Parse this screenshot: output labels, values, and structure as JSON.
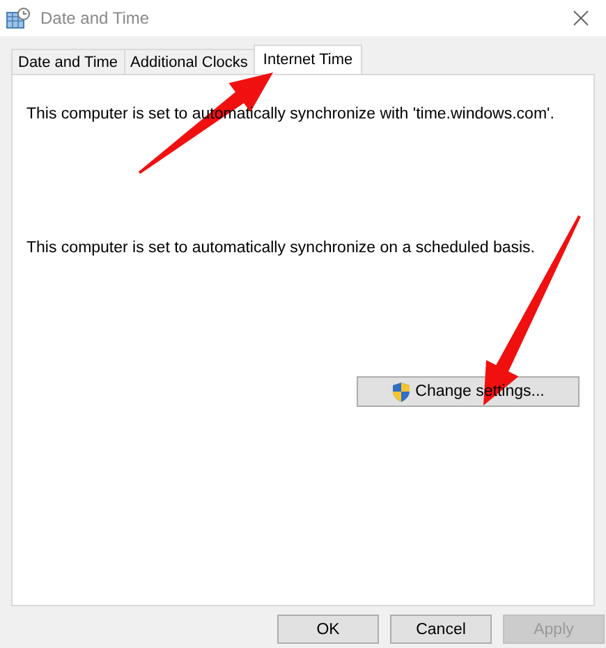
{
  "window": {
    "title": "Date and Time"
  },
  "tabs": [
    {
      "label": "Date and Time",
      "selected": false
    },
    {
      "label": "Additional Clocks",
      "selected": false
    },
    {
      "label": "Internet Time",
      "selected": true
    }
  ],
  "messages": [
    "This computer is set to automatically synchronize with 'time.windows.com'.",
    "This computer is set to automatically synchronize on a scheduled basis."
  ],
  "change_button": {
    "label": "Change settings..."
  },
  "buttons": [
    {
      "label": "OK",
      "disabled": false
    },
    {
      "label": "Cancel",
      "disabled": false
    },
    {
      "label": "Apply",
      "disabled": true
    }
  ],
  "annotations": [
    {
      "kind": "arrow"
    },
    {
      "kind": "arrow"
    }
  ]
}
